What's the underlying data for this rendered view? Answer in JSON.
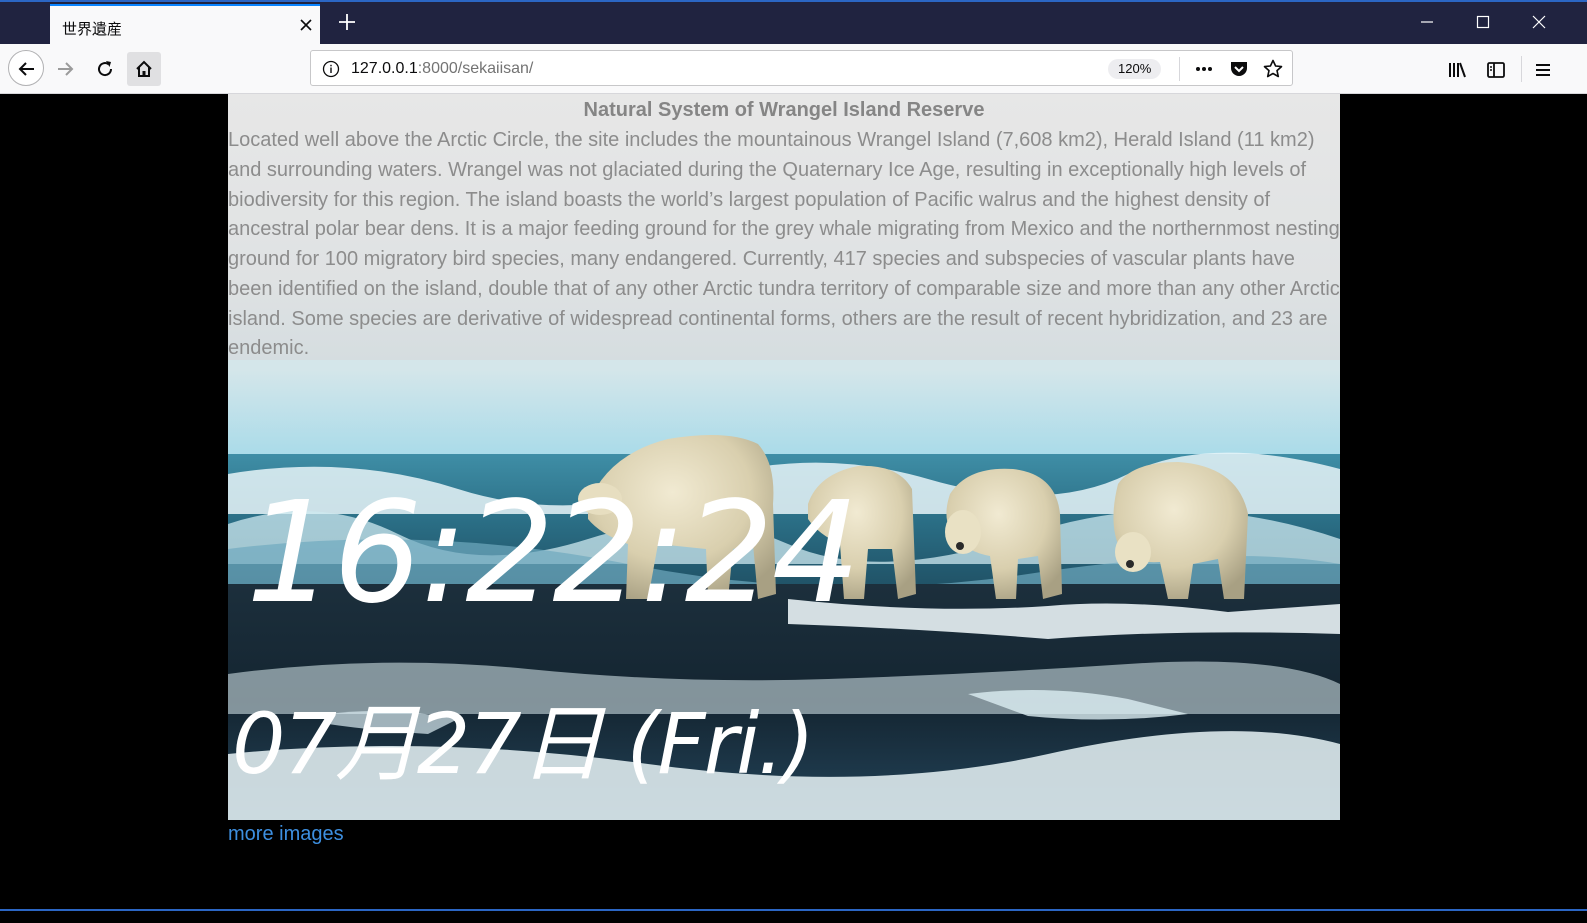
{
  "browser": {
    "tab_title": "世界遺産",
    "url_host": "127.0.0.1",
    "url_path": ":8000/sekaiisan/",
    "zoom": "120%"
  },
  "page": {
    "title": "Natural System of Wrangel Island Reserve",
    "description": "Located well above the Arctic Circle, the site includes the mountainous Wrangel Island (7,608 km2), Herald Island (11 km2) and surrounding waters. Wrangel was not glaciated during the Quaternary Ice Age, resulting in exceptionally high levels of biodiversity for this region. The island boasts the world’s largest population of Pacific walrus and the highest density of ancestral polar bear dens. It is a major feeding ground for the grey whale migrating from Mexico and the northernmost nesting ground for 100 migratory bird species, many endangered. Currently, 417 species and subspecies of vascular plants have been identified on the island, double that of any other Arctic tundra territory of comparable size and more than any other Arctic island. Some species are derivative of widespread continental forms, others are the result of recent hybridization, and 23 are endemic.",
    "clock_time": "16:22:24",
    "clock_date": "07月27日 (Fri.)",
    "more_images_link": "more images"
  },
  "icons": {
    "tab_close": "close-icon",
    "new_tab": "plus-icon",
    "back": "arrow-left-icon",
    "forward": "arrow-right-icon",
    "reload": "reload-icon",
    "home": "home-icon",
    "site_info": "info-icon",
    "page_actions": "more-icon",
    "pocket": "pocket-icon",
    "bookmark": "star-icon",
    "library": "library-icon",
    "sidebar": "sidebar-icon",
    "menu": "hamburger-icon"
  },
  "colors": {
    "titlebar": "#202340",
    "accent": "#0a84ff",
    "link": "#3d8fe0"
  }
}
